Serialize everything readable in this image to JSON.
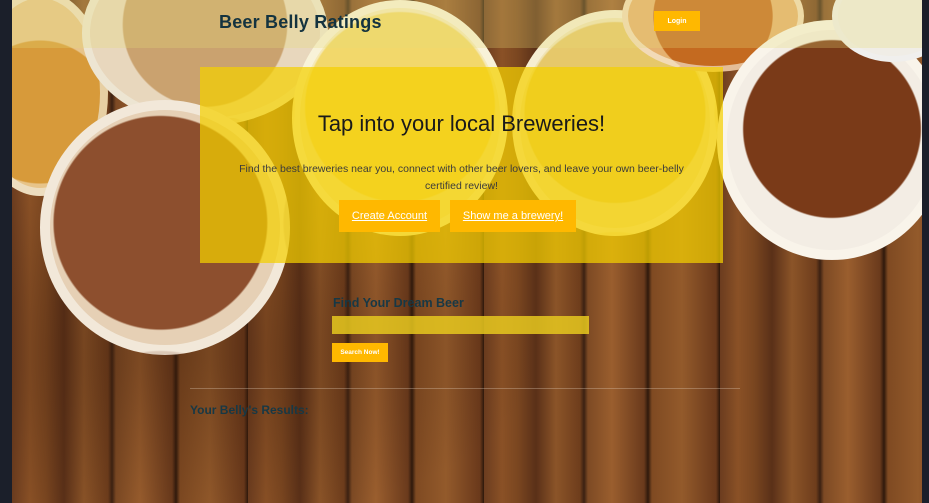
{
  "header": {
    "brand": "Beer Belly Ratings",
    "login_label": "Login"
  },
  "hero": {
    "title": "Tap into your local Breweries!",
    "text": "Find the best breweries near you, connect with other beer lovers, and leave your own beer-belly certified review!",
    "create_account_label": "Create Account",
    "show_brewery_label": "Show me a brewery!"
  },
  "search": {
    "label": "Find Your Dream Beer",
    "value": "",
    "button_label": "Search Now!"
  },
  "results": {
    "title": "Your Belly's Results:"
  },
  "colors": {
    "accent": "#ffb800",
    "hero_bg": "#f4d000",
    "heading": "#173845"
  }
}
